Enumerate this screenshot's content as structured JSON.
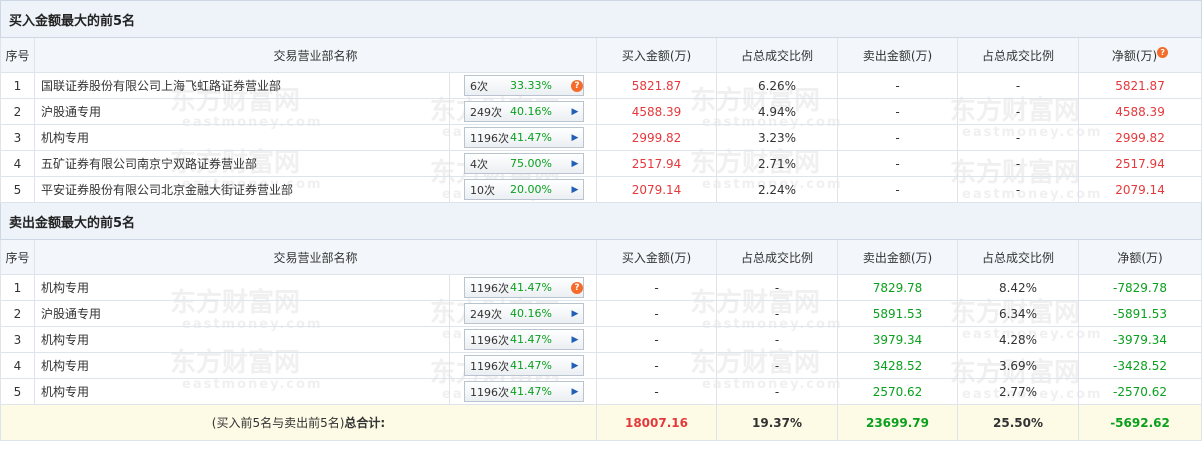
{
  "buy": {
    "title": "买入金额最大的前5名",
    "headers": {
      "idx": "序号",
      "name": "交易营业部名称",
      "buy_amt": "买入金额(万)",
      "buy_pct": "占总成交比例",
      "sell_amt": "卖出金额(万)",
      "sell_pct": "占总成交比例",
      "net": "净额(万)"
    },
    "rows": [
      {
        "idx": "1",
        "name": "国联证券股份有限公司上海飞虹路证券营业部",
        "count": "6次",
        "rate": "33.33%",
        "icon": "question-icon",
        "buy_amt": "5821.87",
        "buy_pct": "6.26%",
        "sell_amt": "-",
        "sell_pct": "-",
        "net": "5821.87"
      },
      {
        "idx": "2",
        "name": "沪股通专用",
        "count": "249次",
        "rate": "40.16%",
        "icon": "arrow-right-icon",
        "buy_amt": "4588.39",
        "buy_pct": "4.94%",
        "sell_amt": "-",
        "sell_pct": "-",
        "net": "4588.39"
      },
      {
        "idx": "3",
        "name": "机构专用",
        "count": "1196次",
        "rate": "41.47%",
        "icon": "arrow-right-icon",
        "buy_amt": "2999.82",
        "buy_pct": "3.23%",
        "sell_amt": "-",
        "sell_pct": "-",
        "net": "2999.82"
      },
      {
        "idx": "4",
        "name": "五矿证券有限公司南京宁双路证券营业部",
        "count": "4次",
        "rate": "75.00%",
        "icon": "arrow-right-icon",
        "buy_amt": "2517.94",
        "buy_pct": "2.71%",
        "sell_amt": "-",
        "sell_pct": "-",
        "net": "2517.94"
      },
      {
        "idx": "5",
        "name": "平安证券股份有限公司北京金融大街证券营业部",
        "count": "10次",
        "rate": "20.00%",
        "icon": "arrow-right-icon",
        "buy_amt": "2079.14",
        "buy_pct": "2.24%",
        "sell_amt": "-",
        "sell_pct": "-",
        "net": "2079.14"
      }
    ]
  },
  "sell": {
    "title": "卖出金额最大的前5名",
    "headers": {
      "idx": "序号",
      "name": "交易营业部名称",
      "buy_amt": "买入金额(万)",
      "buy_pct": "占总成交比例",
      "sell_amt": "卖出金额(万)",
      "sell_pct": "占总成交比例",
      "net": "净额(万)"
    },
    "rows": [
      {
        "idx": "1",
        "name": "机构专用",
        "count": "1196次",
        "rate": "41.47%",
        "icon": "question-icon",
        "buy_amt": "-",
        "buy_pct": "-",
        "sell_amt": "7829.78",
        "sell_pct": "8.42%",
        "net": "-7829.78"
      },
      {
        "idx": "2",
        "name": "沪股通专用",
        "count": "249次",
        "rate": "40.16%",
        "icon": "arrow-right-icon",
        "buy_amt": "-",
        "buy_pct": "-",
        "sell_amt": "5891.53",
        "sell_pct": "6.34%",
        "net": "-5891.53"
      },
      {
        "idx": "3",
        "name": "机构专用",
        "count": "1196次",
        "rate": "41.47%",
        "icon": "arrow-right-icon",
        "buy_amt": "-",
        "buy_pct": "-",
        "sell_amt": "3979.34",
        "sell_pct": "4.28%",
        "net": "-3979.34"
      },
      {
        "idx": "4",
        "name": "机构专用",
        "count": "1196次",
        "rate": "41.47%",
        "icon": "arrow-right-icon",
        "buy_amt": "-",
        "buy_pct": "-",
        "sell_amt": "3428.52",
        "sell_pct": "3.69%",
        "net": "-3428.52"
      },
      {
        "idx": "5",
        "name": "机构专用",
        "count": "1196次",
        "rate": "41.47%",
        "icon": "arrow-right-icon",
        "buy_amt": "-",
        "buy_pct": "-",
        "sell_amt": "2570.62",
        "sell_pct": "2.77%",
        "net": "-2570.62"
      }
    ]
  },
  "total": {
    "label": "(买入前5名与卖出前5名)",
    "label_bold": "总合计:",
    "buy_amt": "18007.16",
    "buy_pct": "19.37%",
    "sell_amt": "23699.79",
    "sell_pct": "25.50%",
    "net": "-5692.62"
  },
  "watermark": {
    "cn": "东方财富网",
    "en": "eastmoney.com"
  },
  "colors": {
    "positive": "#e4393c",
    "negative": "#0aa01e",
    "header_bg": "#eef3f9",
    "total_bg": "#fdfbe6",
    "help_icon": "#f46b2a"
  }
}
